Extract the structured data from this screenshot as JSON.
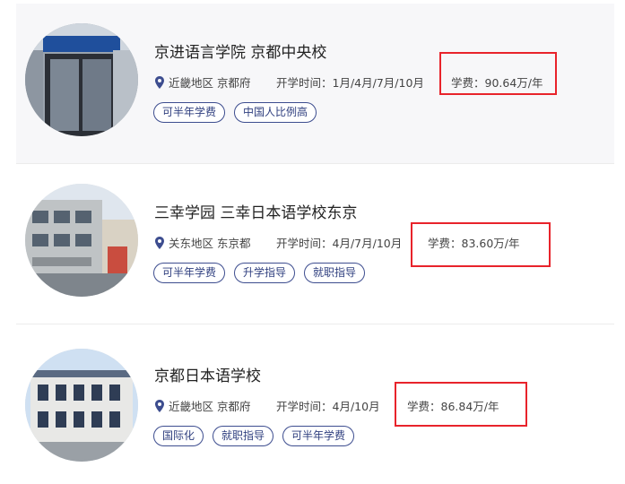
{
  "schools": [
    {
      "name": "京进语言学院 京都中央校",
      "region": "近畿地区 京都府",
      "opening": "开学时间：1月/4月/7月/10月",
      "fee": "学费：90.64万/年",
      "tags": [
        "可半年学费",
        "中国人比例高"
      ]
    },
    {
      "name": "三幸学园 三幸日本语学校东京",
      "region": "关东地区 东京都",
      "opening": "开学时间：4月/7月/10月",
      "fee": "学费：83.60万/年",
      "tags": [
        "可半年学费",
        "升学指导",
        "就职指导"
      ]
    },
    {
      "name": "京都日本语学校",
      "region": "近畿地区 京都府",
      "opening": "开学时间：4月/10月",
      "fee": "学费：86.84万/年",
      "tags": [
        "国际化",
        "就职指导",
        "可半年学费"
      ]
    }
  ],
  "colors": {
    "accent": "#2f3f7f",
    "highlight_box": "#e8232b",
    "pin": "#3d4d8f"
  },
  "icons": {
    "location": "map-pin-icon"
  }
}
